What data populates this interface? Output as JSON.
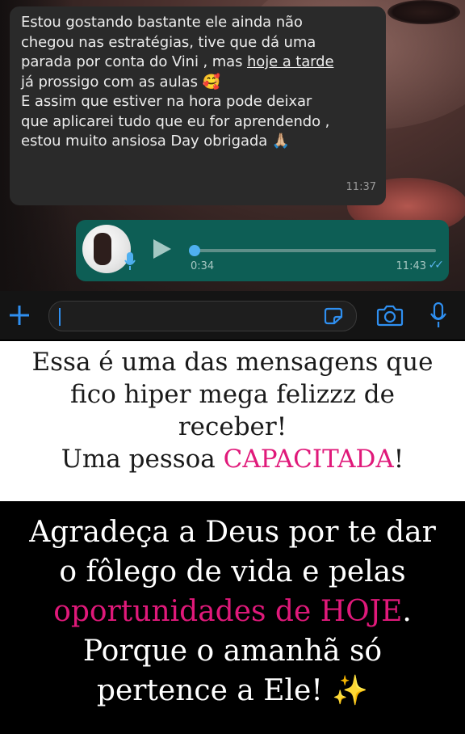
{
  "incoming": {
    "line1": "Estou gostando bastante ele ainda não",
    "line2": "chegou nas estratégias, tive que dá uma",
    "line3_a": "parada por conta do Vini , mas ",
    "line3_b": "hoje a tarde",
    "line4": "já prossigo com as aulas 🥰",
    "line5": "E assim que estiver na hora pode deixar",
    "line6": "que aplicarei tudo que eu for aprendendo ,",
    "line7": "estou muito ansiosa Day obrigada 🙏🏼",
    "time": "11:37"
  },
  "outgoing_audio": {
    "duration": "0:34",
    "time": "11:43",
    "progress": 0.0,
    "status_icon": "double-check-icon"
  },
  "input_bar": {
    "placeholder": "",
    "icons": [
      "plus-icon",
      "sticker-icon",
      "camera-icon",
      "microphone-icon"
    ]
  },
  "caption_white": {
    "line1": "Essa é uma das mensagens que",
    "line2": "fico hiper mega felizzz de",
    "line3": "receber!",
    "line4_a": "Uma pessoa ",
    "line4_pink": "CAPACITADA",
    "line4_b": "!"
  },
  "caption_black": {
    "line1": "Agradeça a Deus por te dar",
    "line2": "o fôlego de vida e pelas",
    "line3_pink": "oportunidades de HOJE",
    "line3_b": ".",
    "line4": "Porque o amanhã só",
    "line5": "pertence a Ele! ",
    "line5_emoji": "✨"
  },
  "colors": {
    "accent_pink": "#e0197a",
    "bubble_in": "#2a2a2a",
    "bubble_out": "#0d5e55",
    "link_blue": "#2f8ff0"
  }
}
